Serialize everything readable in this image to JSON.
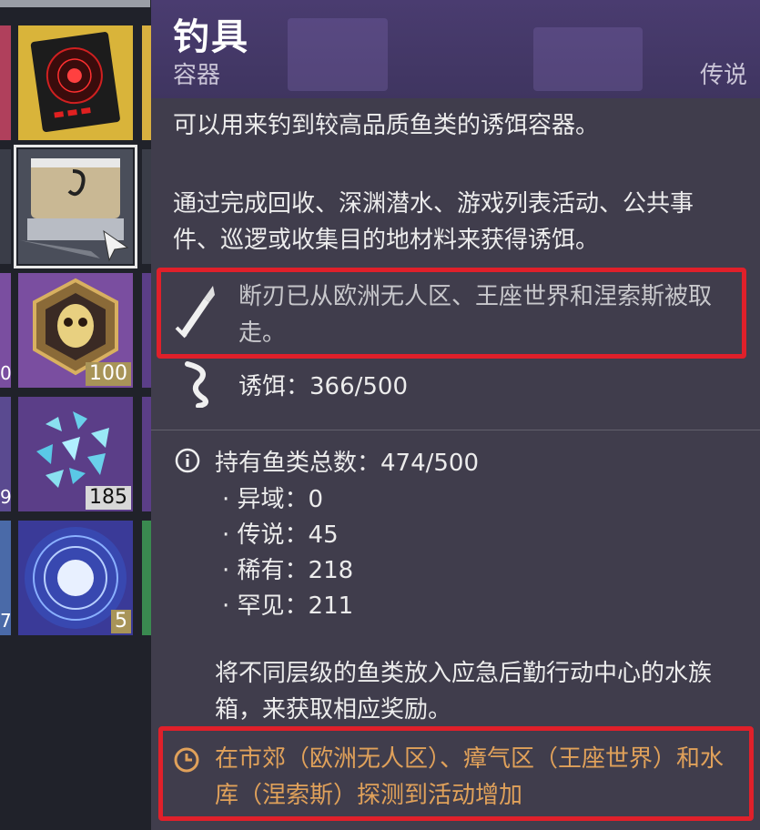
{
  "inventory": {
    "tiles": [
      {
        "name": "tile-engram",
        "qty": ""
      },
      {
        "name": "tile-tackle-box",
        "qty": ""
      },
      {
        "name": "tile-skull-emblem",
        "qty": "100"
      },
      {
        "name": "tile-crystals",
        "qty": "185"
      },
      {
        "name": "tile-orb",
        "qty": "5"
      }
    ],
    "left_edge_qty": [
      "0",
      "9",
      "7"
    ]
  },
  "tooltip": {
    "title": "钓具",
    "subtype": "容器",
    "rarity": "传说",
    "description": "可以用来钓到较高品质鱼类的诱饵容器。",
    "bait_source": "通过完成回收、深渊潜水、游戏列表活动、公共事件、巡逻或收集目的地材料来获得诱饵。",
    "warning": "断刃已从欧洲无人区、王座世界和涅索斯被取走。",
    "bait_count": "诱饵：366/500",
    "fish_total": "持有鱼类总数：474/500",
    "fish_breakdown": [
      {
        "label": "异域：0"
      },
      {
        "label": "传说：45"
      },
      {
        "label": "稀有：218"
      },
      {
        "label": "罕见：211"
      }
    ],
    "aquarium_note": "将不同层级的鱼类放入应急后勤行动中心的水族箱，来获取相应奖励。",
    "activity_notice": "在市郊（欧洲无人区）、瘴气区（王座世界）和水库（涅索斯）探测到活动增加"
  },
  "colors": {
    "highlight": "#e0202a",
    "notice": "#e0a15a",
    "legendary": "#4a3c70"
  }
}
